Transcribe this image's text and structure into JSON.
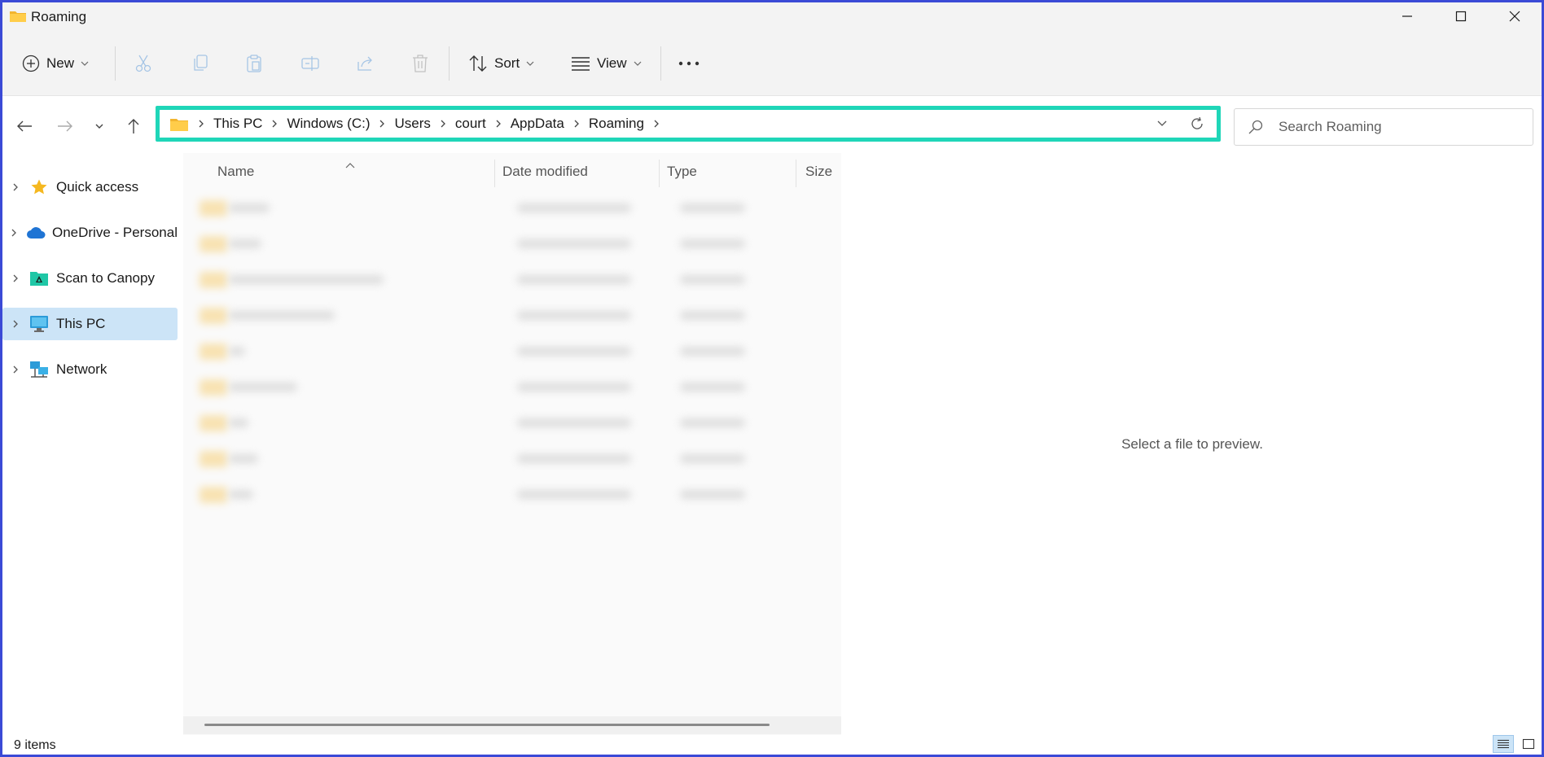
{
  "window": {
    "title": "Roaming"
  },
  "toolbar": {
    "new_label": "New",
    "sort_label": "Sort",
    "view_label": "View"
  },
  "address": {
    "crumbs": [
      "This PC",
      "Windows (C:)",
      "Users",
      "court",
      "AppData",
      "Roaming"
    ]
  },
  "search": {
    "placeholder": "Search Roaming"
  },
  "sidebar": {
    "items": [
      {
        "label": "Quick access"
      },
      {
        "label": "OneDrive - Personal"
      },
      {
        "label": "Scan to Canopy"
      },
      {
        "label": "This PC"
      },
      {
        "label": "Network"
      }
    ]
  },
  "filelist": {
    "columns": {
      "name": "Name",
      "date": "Date modified",
      "type": "Type",
      "size": "Size"
    }
  },
  "preview": {
    "message": "Select a file to preview."
  },
  "status": {
    "item_count": "9 items"
  },
  "colors": {
    "accent": "#1fd6b8",
    "selection": "#cce4f7",
    "frame": "#3b4ad6"
  }
}
